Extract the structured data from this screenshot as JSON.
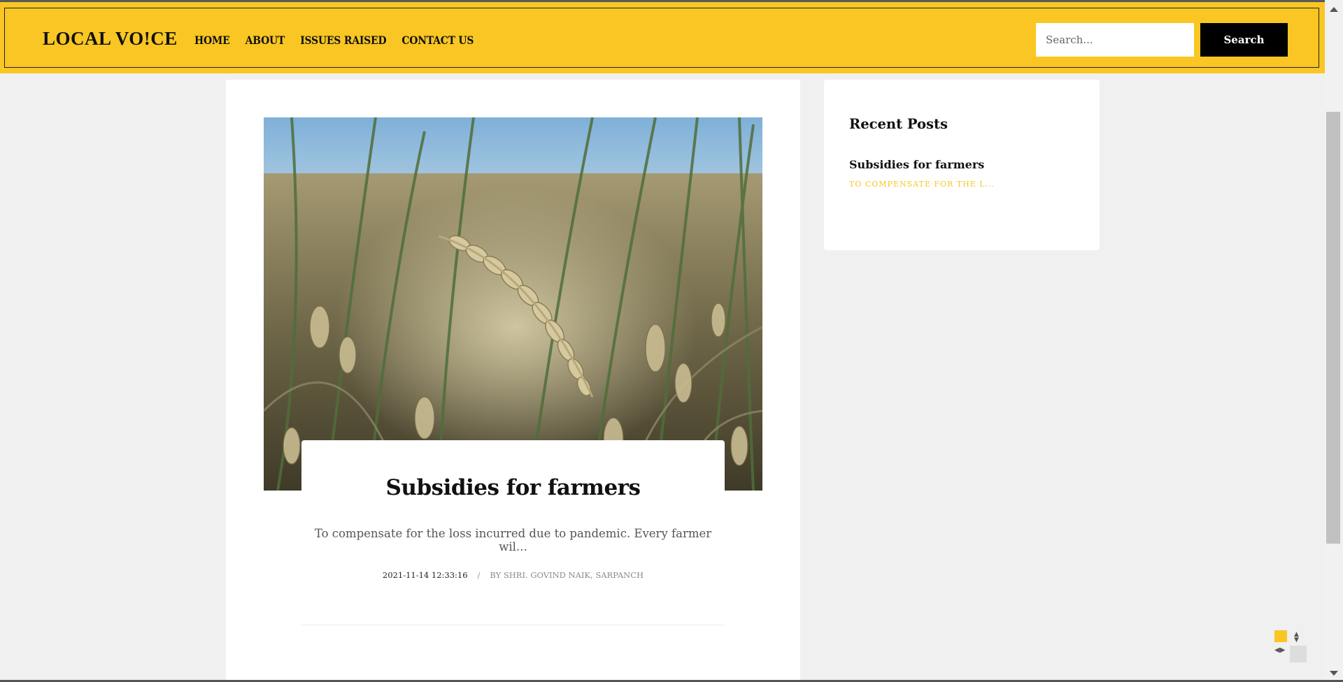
{
  "header": {
    "logo": "LOCAL VO!CE",
    "nav": [
      "HOME",
      "ABOUT",
      "ISSUES RAISED",
      "CONTACT US"
    ],
    "search": {
      "placeholder": "Search...",
      "button_label": "Search"
    }
  },
  "post": {
    "image": "wheat-field-photo",
    "title": "Subsidies for farmers",
    "excerpt": "To compensate for the loss incurred due to pandemic. Every farmer wil...",
    "date": "2021-11-14 12:33:16",
    "separator": "/",
    "author": "BY SHRI. GOVIND NAIK, SARPANCH"
  },
  "sidebar": {
    "widget_title": "Recent Posts",
    "recent": [
      {
        "title": "Subsidies for farmers",
        "excerpt": "TO COMPENSATE FOR THE L..."
      }
    ]
  },
  "colors": {
    "brand_yellow": "#f9c623",
    "header_button": "#000000",
    "page_background": "#f0f0f0"
  },
  "icons": {
    "scroll_up": "arrow-up-icon",
    "scroll_down": "arrow-down-icon",
    "float_updown": "updown-arrows-icon",
    "float_leftright": "leftright-arrows-icon"
  }
}
